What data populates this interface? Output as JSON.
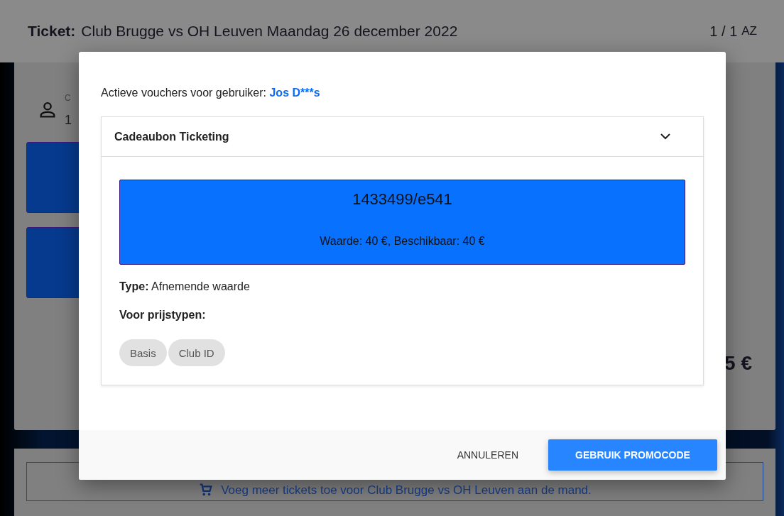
{
  "page": {
    "header": {
      "label": "Ticket:",
      "title": "Club Brugge vs OH Leuven Maandag 26 december 2022",
      "count": "1 / 1",
      "sort": "AZ"
    },
    "card": {
      "caption": "C",
      "value": "1",
      "price": "5 €"
    },
    "cart_link": "Voeg meer tickets toe voor Club Brugge vs OH Leuven aan de mand."
  },
  "dialog": {
    "intro": "Actieve vouchers voor gebruiker:",
    "user": "Jos D***s",
    "vouchers": [
      {
        "title": "Cadeaubon Ticketing",
        "expanded": true,
        "code": "1433499/e541",
        "amounts": "Waarde: 40 €, Beschikbaar: 40 €",
        "type_label": "Type:",
        "type": "Afnemende waarde",
        "price_types_label": "Voor prijstypen:",
        "price_types": [
          "Basis",
          "Club ID"
        ]
      }
    ],
    "buttons": [
      {
        "label": "ANNULEREN",
        "kind": "text"
      },
      {
        "label": "GEBRUIK PROMOCODE",
        "kind": "primary"
      }
    ]
  }
}
